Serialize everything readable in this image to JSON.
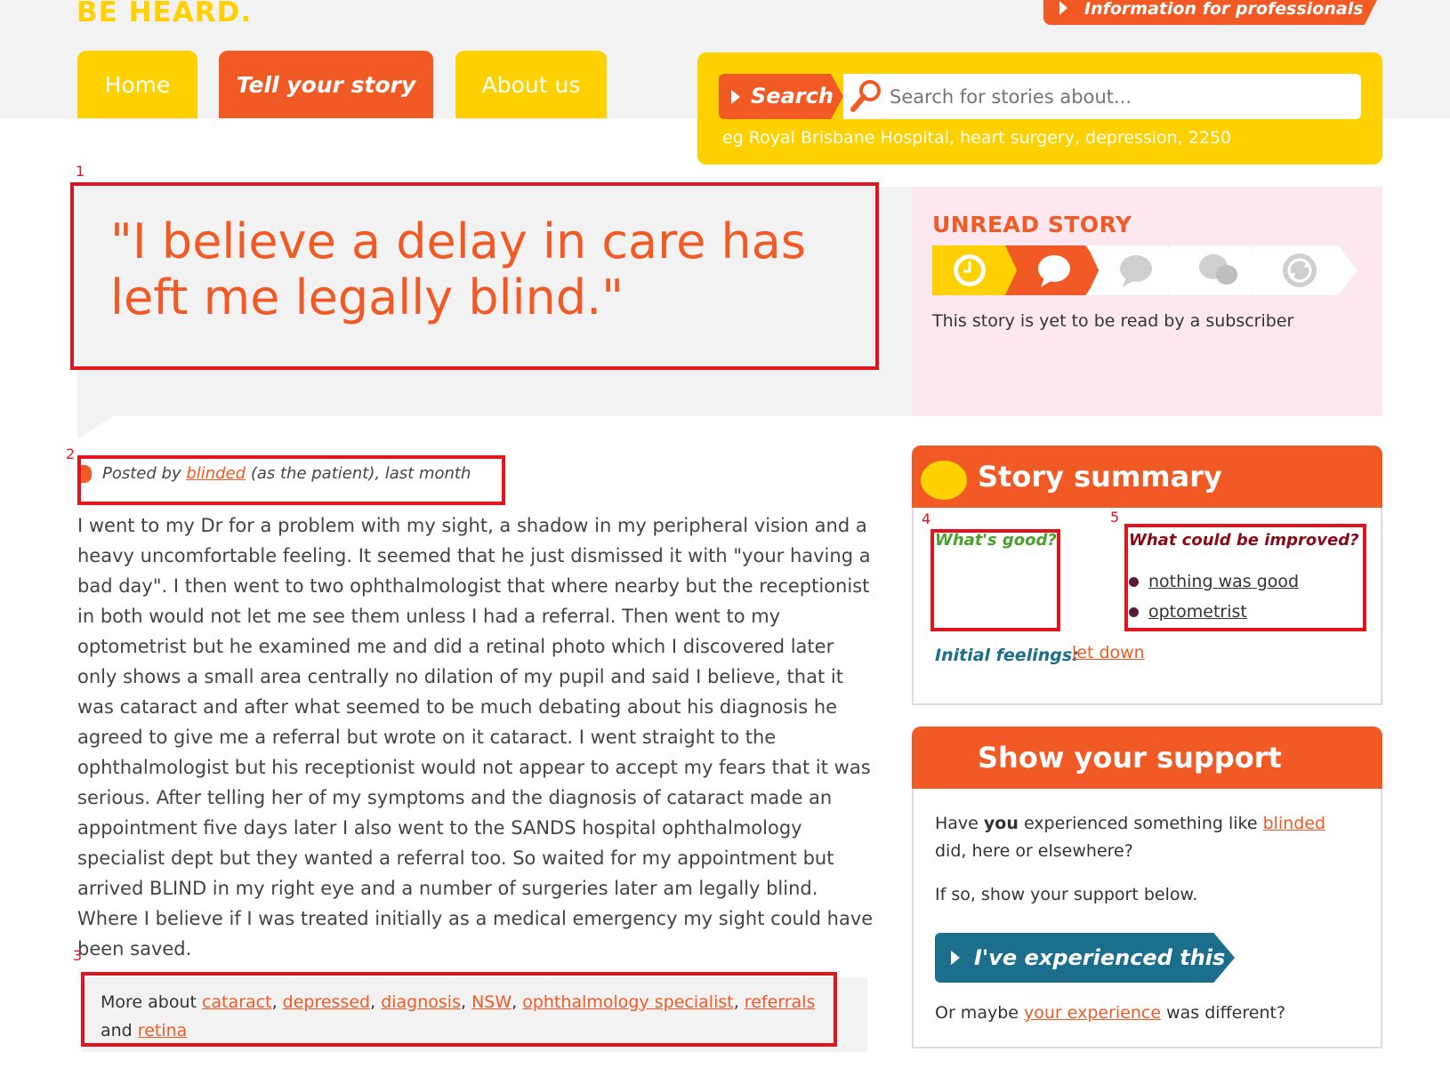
{
  "header": {
    "logo": "BE HEARD.",
    "pro_link": "Information for professionals"
  },
  "nav": {
    "home": "Home",
    "tell": "Tell your story",
    "about": "About us"
  },
  "search": {
    "label": "Search",
    "placeholder": "Search for stories about...",
    "hint": "eg Royal Brisbane Hospital, heart surgery, depression, 2250"
  },
  "story": {
    "title": "\"I believe a delay in care has left me legally blind.\"",
    "posted_prefix": "Posted by",
    "author": "blinded",
    "posted_suffix": "(as the patient), last month",
    "body": "I went to my Dr for a problem with my sight, a shadow in my peripheral vision and a heavy uncomfortable feeling. It seemed that he just dismissed it with \"your having a bad day\". I then went to two ophthalmologist that where nearby but the receptionist in both would not let me see them unless I had a referral. Then went to my optometrist but he examined me and did a retinal photo which I discovered later only shows a small area centrally no dilation of my pupil and said I believe, that it was cataract and after what seemed to be much debating about his diagnosis he agreed to give me a referral but wrote on it cataract. I went straight to the ophthalmologist but his receptionist would not appear to accept my fears that it was serious. After telling her of my symptoms and the diagnosis of cataract made an appointment five days later I also went to the SANDS hospital ophthalmology specialist dept but they wanted a referral too. So waited for my appointment but arrived BLIND in my right eye and a number of surgeries later am legally blind. Where I believe if I was treated initially as a medical emergency my sight could have been saved.",
    "more_prefix": "More about",
    "tags": [
      "cataract",
      "depressed",
      "diagnosis",
      "NSW",
      "ophthalmology specialist",
      "referrals"
    ],
    "tags_and": "and",
    "last_tag": "retina"
  },
  "unread": {
    "title": "UNREAD STORY",
    "desc": "This story is yet to be read by a subscriber",
    "steps": [
      {
        "icon": "clock-icon",
        "color": "#ffd100"
      },
      {
        "icon": "speech-bubble-icon",
        "color": "#f15a24"
      },
      {
        "icon": "speech-bubble-grey-icon",
        "color": "#ffffff"
      },
      {
        "icon": "two-bubbles-icon",
        "color": "#ffffff"
      },
      {
        "icon": "refresh-icon",
        "color": "#ffffff"
      }
    ]
  },
  "summary": {
    "title": "Story summary",
    "good_title": "What's good?",
    "improve_title": "What could be improved?",
    "improve_items": [
      "nothing was good",
      "optometrist"
    ],
    "feelings_label": "Initial feelings:",
    "feelings_value": "let down"
  },
  "support": {
    "title": "Show your support",
    "p1_a": "Have",
    "p1_you": "you",
    "p1_b": "experienced something like",
    "p1_link": "blinded",
    "p1_c": "did, here or elsewhere?",
    "p2": "If so, show your support below.",
    "button": "I've experienced this",
    "p3_a": "Or maybe",
    "p3_link": "your experience",
    "p3_b": "was different?"
  },
  "annotations": [
    "1",
    "2",
    "3",
    "4",
    "5"
  ],
  "colors": {
    "accent": "#f15a24",
    "yellow": "#ffd100",
    "teal": "#1b6f8c",
    "annotation_red": "#e3141e"
  }
}
